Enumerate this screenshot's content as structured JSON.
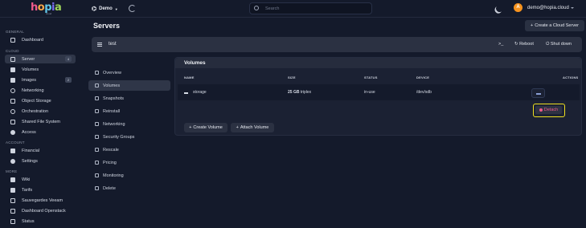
{
  "header": {
    "logo_text": "hopia",
    "logo_sub": "cloud",
    "project": "Demo",
    "search_placeholder": "Search",
    "avatar_letter": "A",
    "user_email": "demo@hopia.cloud"
  },
  "sidebar": {
    "sections": {
      "general": "GENERAL",
      "cloud": "CLOUD",
      "account": "ACCOUNT",
      "more": "MORE"
    },
    "items": [
      {
        "label": "Dashboard",
        "icon": "dashboard-icon"
      },
      {
        "label": "Server",
        "badge": "4",
        "icon": "server-icon"
      },
      {
        "label": "Volumes",
        "icon": "volumes-icon"
      },
      {
        "label": "Images",
        "badge": "2",
        "icon": "images-icon"
      },
      {
        "label": "Networking",
        "icon": "networking-icon"
      },
      {
        "label": "Object Storage",
        "icon": "object-storage-icon"
      },
      {
        "label": "Orchestration",
        "icon": "orchestration-icon"
      },
      {
        "label": "Shared File System",
        "icon": "shared-fs-icon"
      },
      {
        "label": "Access",
        "icon": "access-icon"
      },
      {
        "label": "Financial",
        "icon": "financial-icon"
      },
      {
        "label": "Settings",
        "icon": "settings-icon"
      },
      {
        "label": "Wiki",
        "icon": "wiki-icon"
      },
      {
        "label": "Tarifs",
        "icon": "tarifs-icon"
      },
      {
        "label": "Sauvegardes Veeam",
        "icon": "veeam-icon"
      },
      {
        "label": "Dashboard Openstack",
        "icon": "openstack-icon"
      },
      {
        "label": "Status",
        "icon": "status-icon"
      }
    ]
  },
  "page": {
    "title": "Servers",
    "create_button": "Create a Cloud Server"
  },
  "server": {
    "name": "test",
    "console_label": ">_",
    "reboot": "Reboot",
    "shutdown": "Shut down"
  },
  "subnav": [
    "Overview",
    "Volumes",
    "Snapshots",
    "Reinstall",
    "Networking",
    "Security Groups",
    "Rescale",
    "Pricing",
    "Monitoring",
    "Delete"
  ],
  "volumes": {
    "title": "Volumes",
    "headers": {
      "name": "NAME",
      "size": "SIZE",
      "status": "STATUS",
      "device": "DEVICE",
      "actions": "ACTIONS"
    },
    "rows": [
      {
        "name": "storage",
        "size_value": "25 GB",
        "size_type": "triplex",
        "status": "in-use",
        "device": "/dev/sdb",
        "action": "Detach"
      }
    ],
    "create_button": "Create Volume",
    "attach_button": "Attach Volume"
  }
}
